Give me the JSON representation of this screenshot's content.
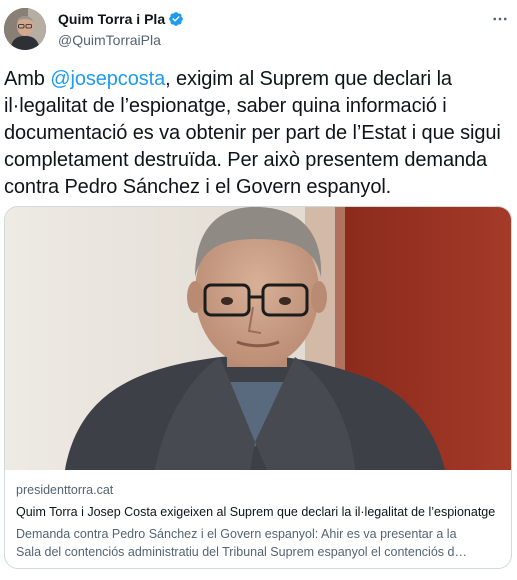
{
  "author": {
    "display_name": "Quim Torra i Pla",
    "handle": "@QuimTorraiPla",
    "verified": true
  },
  "tweet": {
    "text_before": "Amb ",
    "mention": "@josepcosta",
    "text_after": ", exigim al Suprem que declari la il·legalitat de l’espionatge, saber quina informació i documentació es va obtenir per part de l’Estat i que sigui completament destruïda. Per això presentem demanda contra Pedro Sánchez i el Govern espanyol."
  },
  "link_card": {
    "domain": "presidenttorra.cat",
    "title": "Quim Torra i Josep Costa exigeixen al Suprem que declari la il·legalitat de l’espionatge",
    "description_line1": "Demanda contra Pedro Sánchez i el Govern espanyol: Ahir es va presentar a la",
    "description_line2": "Sala del contenciós administratiu del Tribunal Suprem espanyol el contenciós d…"
  },
  "colors": {
    "accent": "#1d9bf0",
    "secondary_text": "#536471",
    "border": "#cfd9de"
  },
  "icons": {
    "more": "more-horizontal-icon",
    "verified": "verified-badge-icon"
  }
}
